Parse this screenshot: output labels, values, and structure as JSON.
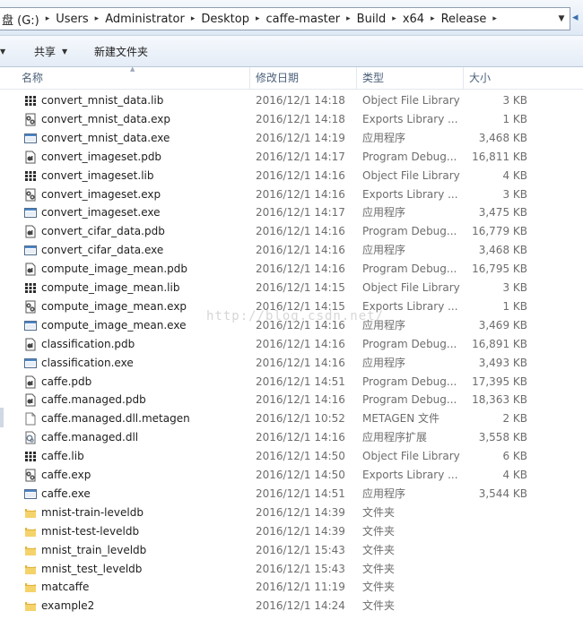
{
  "address": {
    "crumbs": [
      "盘 (G:)",
      "Users",
      "Administrator",
      "Desktop",
      "caffe-master",
      "Build",
      "x64",
      "Release"
    ]
  },
  "toolbar": {
    "share_label": "共享",
    "new_folder_label": "新建文件夹"
  },
  "columns": {
    "name": "名称",
    "date": "修改日期",
    "type": "类型",
    "size": "大小"
  },
  "watermark": "http://blog.csdn.net/",
  "files": [
    {
      "name": "convert_mnist_data.lib",
      "date": "2016/12/1 14:18",
      "type": "Object File Library",
      "size": "3 KB",
      "icon": "lib-icon"
    },
    {
      "name": "convert_mnist_data.exp",
      "date": "2016/12/1 14:18",
      "type": "Exports Library ...",
      "size": "1 KB",
      "icon": "exp-icon"
    },
    {
      "name": "convert_mnist_data.exe",
      "date": "2016/12/1 14:19",
      "type": "应用程序",
      "size": "3,468 KB",
      "icon": "exe-icon"
    },
    {
      "name": "convert_imageset.pdb",
      "date": "2016/12/1 14:17",
      "type": "Program Debug...",
      "size": "16,811 KB",
      "icon": "pdb-icon"
    },
    {
      "name": "convert_imageset.lib",
      "date": "2016/12/1 14:16",
      "type": "Object File Library",
      "size": "4 KB",
      "icon": "lib-icon"
    },
    {
      "name": "convert_imageset.exp",
      "date": "2016/12/1 14:16",
      "type": "Exports Library ...",
      "size": "3 KB",
      "icon": "exp-icon"
    },
    {
      "name": "convert_imageset.exe",
      "date": "2016/12/1 14:17",
      "type": "应用程序",
      "size": "3,475 KB",
      "icon": "exe-icon"
    },
    {
      "name": "convert_cifar_data.pdb",
      "date": "2016/12/1 14:16",
      "type": "Program Debug...",
      "size": "16,779 KB",
      "icon": "pdb-icon"
    },
    {
      "name": "convert_cifar_data.exe",
      "date": "2016/12/1 14:16",
      "type": "应用程序",
      "size": "3,468 KB",
      "icon": "exe-icon"
    },
    {
      "name": "compute_image_mean.pdb",
      "date": "2016/12/1 14:16",
      "type": "Program Debug...",
      "size": "16,795 KB",
      "icon": "pdb-icon"
    },
    {
      "name": "compute_image_mean.lib",
      "date": "2016/12/1 14:15",
      "type": "Object File Library",
      "size": "3 KB",
      "icon": "lib-icon"
    },
    {
      "name": "compute_image_mean.exp",
      "date": "2016/12/1 14:15",
      "type": "Exports Library ...",
      "size": "1 KB",
      "icon": "exp-icon"
    },
    {
      "name": "compute_image_mean.exe",
      "date": "2016/12/1 14:16",
      "type": "应用程序",
      "size": "3,469 KB",
      "icon": "exe-icon"
    },
    {
      "name": "classification.pdb",
      "date": "2016/12/1 14:16",
      "type": "Program Debug...",
      "size": "16,891 KB",
      "icon": "pdb-icon"
    },
    {
      "name": "classification.exe",
      "date": "2016/12/1 14:16",
      "type": "应用程序",
      "size": "3,493 KB",
      "icon": "exe-icon"
    },
    {
      "name": "caffe.pdb",
      "date": "2016/12/1 14:51",
      "type": "Program Debug...",
      "size": "17,395 KB",
      "icon": "pdb-icon"
    },
    {
      "name": "caffe.managed.pdb",
      "date": "2016/12/1 14:16",
      "type": "Program Debug...",
      "size": "18,363 KB",
      "icon": "pdb-icon"
    },
    {
      "name": "caffe.managed.dll.metagen",
      "date": "2016/12/1 10:52",
      "type": "METAGEN 文件",
      "size": "2 KB",
      "icon": "blank-file-icon"
    },
    {
      "name": "caffe.managed.dll",
      "date": "2016/12/1 14:16",
      "type": "应用程序扩展",
      "size": "3,558 KB",
      "icon": "dll-icon"
    },
    {
      "name": "caffe.lib",
      "date": "2016/12/1 14:50",
      "type": "Object File Library",
      "size": "6 KB",
      "icon": "lib-icon"
    },
    {
      "name": "caffe.exp",
      "date": "2016/12/1 14:50",
      "type": "Exports Library ...",
      "size": "4 KB",
      "icon": "exp-icon"
    },
    {
      "name": "caffe.exe",
      "date": "2016/12/1 14:51",
      "type": "应用程序",
      "size": "3,544 KB",
      "icon": "exe-icon"
    },
    {
      "name": "mnist-train-leveldb",
      "date": "2016/12/1 14:39",
      "type": "文件夹",
      "size": "",
      "icon": "folder-icon"
    },
    {
      "name": "mnist-test-leveldb",
      "date": "2016/12/1 14:39",
      "type": "文件夹",
      "size": "",
      "icon": "folder-icon"
    },
    {
      "name": "mnist_train_leveldb",
      "date": "2016/12/1 15:43",
      "type": "文件夹",
      "size": "",
      "icon": "folder-icon"
    },
    {
      "name": "mnist_test_leveldb",
      "date": "2016/12/1 15:43",
      "type": "文件夹",
      "size": "",
      "icon": "folder-icon"
    },
    {
      "name": "matcaffe",
      "date": "2016/12/1 11:19",
      "type": "文件夹",
      "size": "",
      "icon": "folder-icon"
    },
    {
      "name": "example2",
      "date": "2016/12/1 14:24",
      "type": "文件夹",
      "size": "",
      "icon": "folder-icon"
    }
  ]
}
